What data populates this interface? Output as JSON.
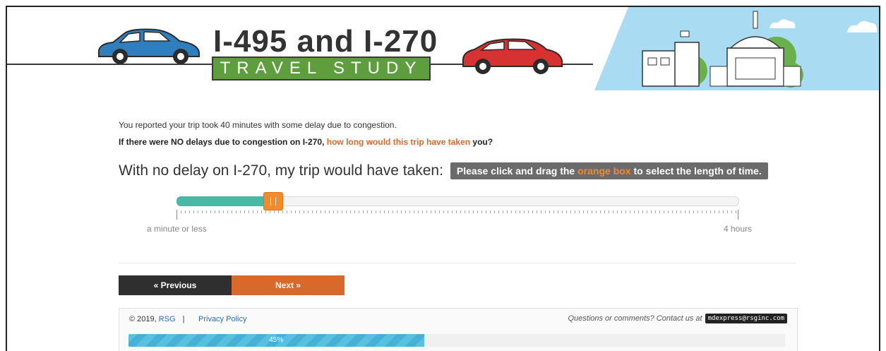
{
  "header": {
    "title_main": "I-495 and I-270",
    "title_sub": "TRAVEL STUDY"
  },
  "question": {
    "intro": "You reported your trip took 40 minutes with some delay due to congestion.",
    "main_before": "If there were NO delays due to congestion on I-270, ",
    "main_highlight": "how long would this trip have taken",
    "main_after": " you?",
    "prompt": "With no delay on I-270, my trip would have taken:",
    "hint_before": "Please click and drag the ",
    "hint_highlight": "orange box",
    "hint_after": " to select the length of time."
  },
  "slider": {
    "min_label": "a minute or less",
    "max_label": "4 hours",
    "value_fraction": 0.165
  },
  "nav": {
    "prev_label": "« Previous",
    "next_label": "Next »"
  },
  "footer": {
    "copyright": "© 2019,",
    "company": "RSG",
    "separator": "|",
    "privacy": "Privacy Policy",
    "contact_text": "Questions or comments? Contact us at",
    "email": "mdexpress@rsginc.com",
    "progress_label": "45%",
    "progress_value": 0.45
  },
  "colors": {
    "accent_orange": "#d9692a",
    "slider_fill": "#4ab8a5",
    "title_green": "#5f9e3c",
    "progress": "#5bbfe0"
  }
}
